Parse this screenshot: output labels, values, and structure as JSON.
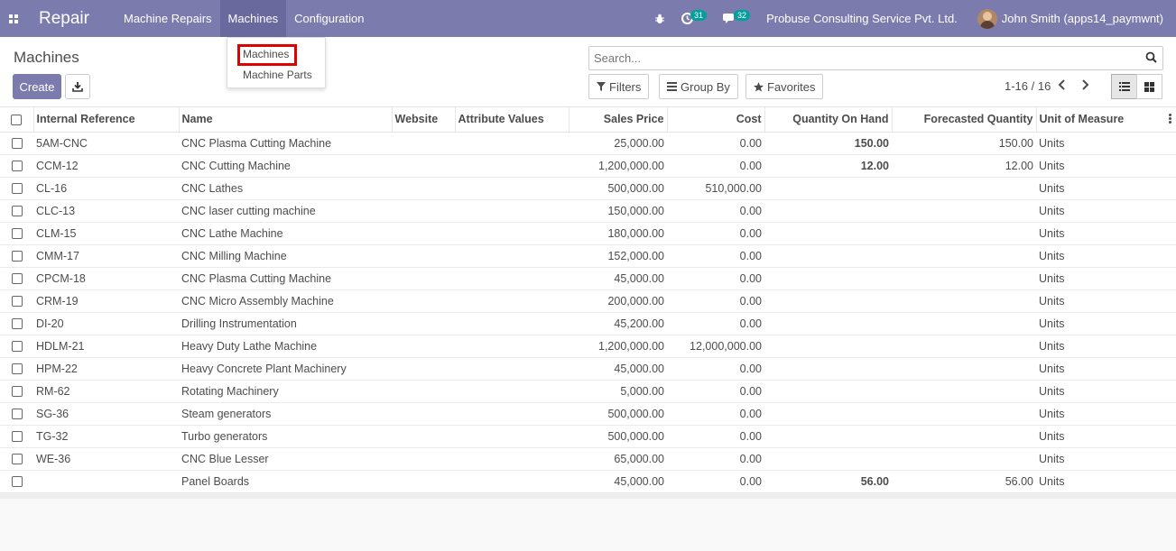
{
  "app": {
    "name": "Repair"
  },
  "topmenu": [
    {
      "label": "Machine Repairs"
    },
    {
      "label": "Machines"
    },
    {
      "label": "Configuration"
    }
  ],
  "systray": {
    "activity_count": "31",
    "message_count": "32",
    "company": "Probuse Consulting Service Pvt. Ltd.",
    "user": "John Smith (apps14_paymwnt)"
  },
  "dropdown": {
    "items": [
      {
        "label": "Machines"
      },
      {
        "label": "Machine Parts"
      }
    ]
  },
  "control": {
    "breadcrumb": "Machines",
    "create_label": "Create",
    "search_placeholder": "Search...",
    "filters_label": "Filters",
    "groupby_label": "Group By",
    "favorites_label": "Favorites",
    "pager": "1-16 / 16"
  },
  "table": {
    "headers": {
      "internal_reference": "Internal Reference",
      "name": "Name",
      "website": "Website",
      "attribute_values": "Attribute Values",
      "sales_price": "Sales Price",
      "cost": "Cost",
      "qty_on_hand": "Quantity On Hand",
      "forecasted_qty": "Forecasted Quantity",
      "uom": "Unit of Measure"
    },
    "rows": [
      {
        "ref": "5AM-CNC",
        "name": "CNC Plasma Cutting Machine",
        "price": "25,000.00",
        "cost": "0.00",
        "onhand": "150.00",
        "forecast": "150.00",
        "uom": "Units"
      },
      {
        "ref": "CCM-12",
        "name": "CNC Cutting Machine",
        "price": "1,200,000.00",
        "cost": "0.00",
        "onhand": "12.00",
        "forecast": "12.00",
        "uom": "Units"
      },
      {
        "ref": "CL-16",
        "name": "CNC Lathes",
        "price": "500,000.00",
        "cost": "510,000.00",
        "onhand": "",
        "forecast": "",
        "uom": "Units"
      },
      {
        "ref": "CLC-13",
        "name": "CNC laser cutting machine",
        "price": "150,000.00",
        "cost": "0.00",
        "onhand": "",
        "forecast": "",
        "uom": "Units"
      },
      {
        "ref": "CLM-15",
        "name": "CNC Lathe Machine",
        "price": "180,000.00",
        "cost": "0.00",
        "onhand": "",
        "forecast": "",
        "uom": "Units"
      },
      {
        "ref": "CMM-17",
        "name": "CNC Milling Machine",
        "price": "152,000.00",
        "cost": "0.00",
        "onhand": "",
        "forecast": "",
        "uom": "Units"
      },
      {
        "ref": "CPCM-18",
        "name": "CNC Plasma Cutting Machine",
        "price": "45,000.00",
        "cost": "0.00",
        "onhand": "",
        "forecast": "",
        "uom": "Units"
      },
      {
        "ref": "CRM-19",
        "name": "CNC Micro Assembly Machine",
        "price": "200,000.00",
        "cost": "0.00",
        "onhand": "",
        "forecast": "",
        "uom": "Units"
      },
      {
        "ref": "DI-20",
        "name": "Drilling Instrumentation",
        "price": "45,200.00",
        "cost": "0.00",
        "onhand": "",
        "forecast": "",
        "uom": "Units"
      },
      {
        "ref": "HDLM-21",
        "name": "Heavy Duty Lathe Machine",
        "price": "1,200,000.00",
        "cost": "12,000,000.00",
        "onhand": "",
        "forecast": "",
        "uom": "Units"
      },
      {
        "ref": "HPM-22",
        "name": "Heavy Concrete Plant Machinery",
        "price": "45,000.00",
        "cost": "0.00",
        "onhand": "",
        "forecast": "",
        "uom": "Units"
      },
      {
        "ref": "RM-62",
        "name": "Rotating Machinery",
        "price": "5,000.00",
        "cost": "0.00",
        "onhand": "",
        "forecast": "",
        "uom": "Units"
      },
      {
        "ref": "SG-36",
        "name": "Steam generators",
        "price": "500,000.00",
        "cost": "0.00",
        "onhand": "",
        "forecast": "",
        "uom": "Units"
      },
      {
        "ref": "TG-32",
        "name": "Turbo generators",
        "price": "500,000.00",
        "cost": "0.00",
        "onhand": "",
        "forecast": "",
        "uom": "Units"
      },
      {
        "ref": "WE-36",
        "name": "CNC Blue Lesser",
        "price": "65,000.00",
        "cost": "0.00",
        "onhand": "",
        "forecast": "",
        "uom": "Units"
      },
      {
        "ref": "",
        "name": "Panel Boards",
        "price": "45,000.00",
        "cost": "0.00",
        "onhand": "56.00",
        "forecast": "56.00",
        "uom": "Units"
      }
    ]
  },
  "colors": {
    "brand": "#7c7bad",
    "badge": "#00a09d",
    "highlight": "#e00000"
  }
}
